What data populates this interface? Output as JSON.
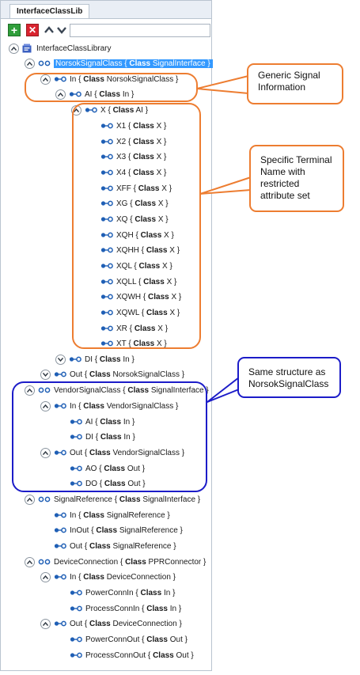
{
  "window": {
    "tab_label": "InterfaceClassLib",
    "search_value": ""
  },
  "icons": {
    "add": "plus-icon",
    "delete": "x-icon",
    "up": "chevron-up-icon",
    "down": "chevron-down-icon"
  },
  "colors": {
    "selection": "#3399ff",
    "callout_orange": "#ed7d31",
    "callout_blue": "#1c1cc8",
    "add_green": "#2f9e3a",
    "delete_red": "#d9232e"
  },
  "tree": {
    "root": "InterfaceClassLibrary",
    "norsok": {
      "label": "NorsokSignalClass",
      "kw": "Class",
      "ref": "SignalInterface"
    },
    "norsok_in": {
      "label": "In",
      "kw": "Class",
      "ref": "NorsokSignalClass"
    },
    "norsok_ai": {
      "label": "AI",
      "kw": "Class",
      "ref": "In"
    },
    "norsok_x": {
      "label": "X",
      "kw": "Class",
      "ref": "AI"
    },
    "terminals": [
      {
        "label": "X1",
        "kw": "Class",
        "ref": "X"
      },
      {
        "label": "X2",
        "kw": "Class",
        "ref": "X"
      },
      {
        "label": "X3",
        "kw": "Class",
        "ref": "X"
      },
      {
        "label": "X4",
        "kw": "Class",
        "ref": "X"
      },
      {
        "label": "XFF",
        "kw": "Class",
        "ref": "X"
      },
      {
        "label": "XG",
        "kw": "Class",
        "ref": "X"
      },
      {
        "label": "XQ",
        "kw": "Class",
        "ref": "X"
      },
      {
        "label": "XQH",
        "kw": "Class",
        "ref": "X"
      },
      {
        "label": "XQHH",
        "kw": "Class",
        "ref": "X"
      },
      {
        "label": "XQL",
        "kw": "Class",
        "ref": "X"
      },
      {
        "label": "XQLL",
        "kw": "Class",
        "ref": "X"
      },
      {
        "label": "XQWH",
        "kw": "Class",
        "ref": "X"
      },
      {
        "label": "XQWL",
        "kw": "Class",
        "ref": "X"
      },
      {
        "label": "XR",
        "kw": "Class",
        "ref": "X"
      },
      {
        "label": "XT",
        "kw": "Class",
        "ref": "X"
      }
    ],
    "norsok_di": {
      "label": "DI",
      "kw": "Class",
      "ref": "In"
    },
    "norsok_out": {
      "label": "Out",
      "kw": "Class",
      "ref": "NorsokSignalClass"
    },
    "vendor": {
      "label": "VendorSignalClass",
      "kw": "Class",
      "ref": "SignalInterface"
    },
    "vendor_in": {
      "label": "In",
      "kw": "Class",
      "ref": "VendorSignalClass"
    },
    "vendor_ai": {
      "label": "AI",
      "kw": "Class",
      "ref": "In"
    },
    "vendor_di": {
      "label": "DI",
      "kw": "Class",
      "ref": "In"
    },
    "vendor_out": {
      "label": "Out",
      "kw": "Class",
      "ref": "VendorSignalClass"
    },
    "vendor_ao": {
      "label": "AO",
      "kw": "Class",
      "ref": "Out"
    },
    "vendor_do": {
      "label": "DO",
      "kw": "Class",
      "ref": "Out"
    },
    "sigref": {
      "label": "SignalReference",
      "kw": "Class",
      "ref": "SignalInterface"
    },
    "sigref_in": {
      "label": "In",
      "kw": "Class",
      "ref": "SignalReference"
    },
    "sigref_inout": {
      "label": "InOut",
      "kw": "Class",
      "ref": "SignalReference"
    },
    "sigref_out": {
      "label": "Out",
      "kw": "Class",
      "ref": "SignalReference"
    },
    "devconn": {
      "label": "DeviceConnection",
      "kw": "Class",
      "ref": "PPRConnector"
    },
    "devconn_in": {
      "label": "In",
      "kw": "Class",
      "ref": "DeviceConnection"
    },
    "devconn_powerin": {
      "label": "PowerConnIn",
      "kw": "Class",
      "ref": "In"
    },
    "devconn_processin": {
      "label": "ProcessConnIn",
      "kw": "Class",
      "ref": "In"
    },
    "devconn_out": {
      "label": "Out",
      "kw": "Class",
      "ref": "DeviceConnection"
    },
    "devconn_powerout": {
      "label": "PowerConnOut",
      "kw": "Class",
      "ref": "Out"
    },
    "devconn_processout": {
      "label": "ProcessConnOut",
      "kw": "Class",
      "ref": "Out"
    }
  },
  "callouts": {
    "generic": "Generic Signal Information",
    "specific": "Specific Terminal Name with restricted attribute set",
    "same": "Same structure as NorsokSignalClass"
  }
}
